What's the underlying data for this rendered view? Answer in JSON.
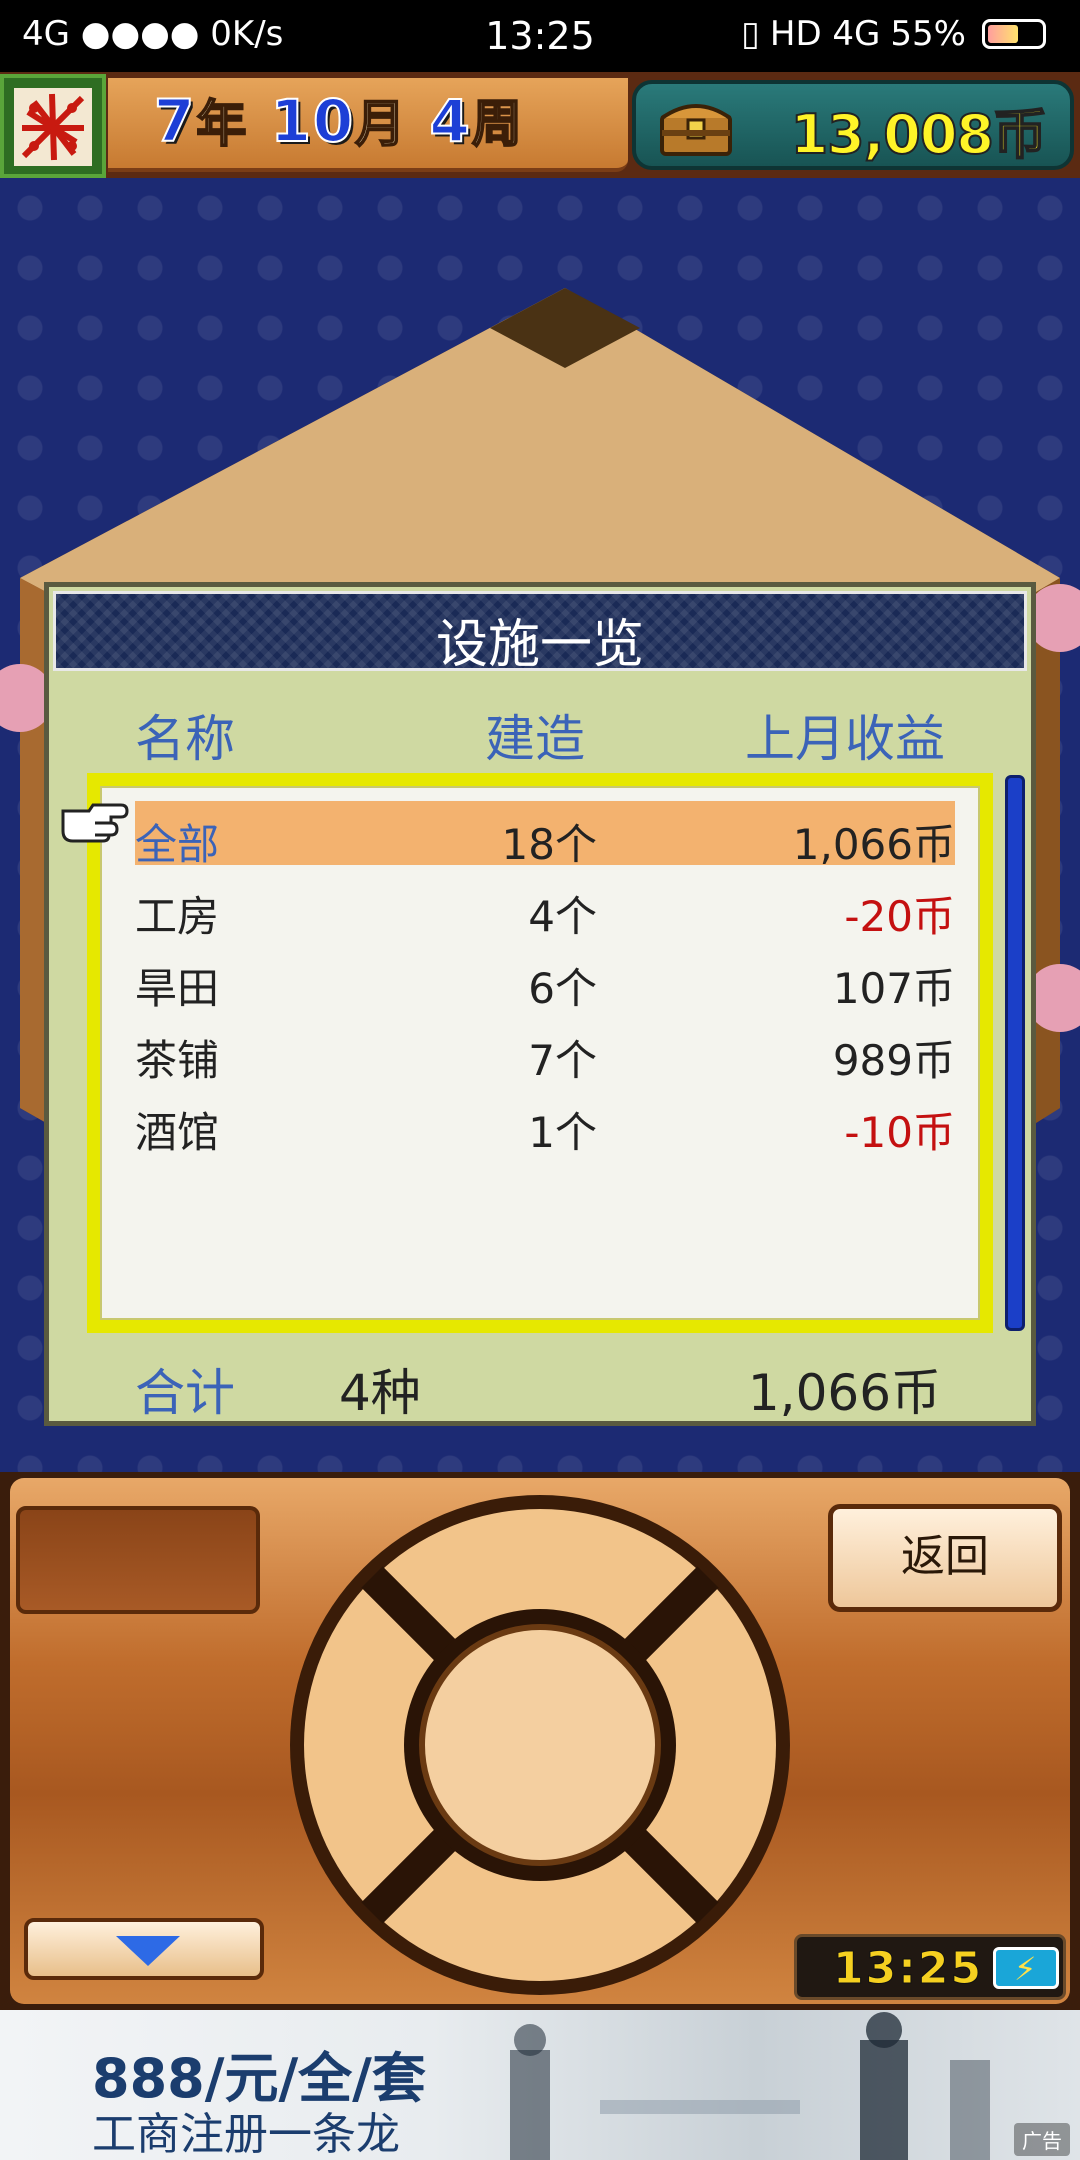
{
  "status_bar": {
    "network": "4G ●●●● 0K/s",
    "time": "13:25",
    "indicators": "HD 4G",
    "battery_percent": "55%",
    "battery_level": 0.55
  },
  "game_header": {
    "date": {
      "year": "7",
      "year_unit": "年",
      "month": "10",
      "month_unit": "月",
      "week": "4",
      "week_unit": "周"
    },
    "money": "13,008币"
  },
  "dialog": {
    "title": "设施一览",
    "columns": {
      "name": "名称",
      "built": "建造",
      "income": "上月收益"
    },
    "rows": [
      {
        "name": "全部",
        "count": "18个",
        "income": "1,066币",
        "negative": false,
        "selected": true
      },
      {
        "name": "工房",
        "count": "4个",
        "income": "-20币",
        "negative": true,
        "selected": false
      },
      {
        "name": "旱田",
        "count": "6个",
        "income": "107币",
        "negative": false,
        "selected": false
      },
      {
        "name": "茶铺",
        "count": "7个",
        "income": "989币",
        "negative": false,
        "selected": false
      },
      {
        "name": "酒馆",
        "count": "1个",
        "income": "-10币",
        "negative": true,
        "selected": false
      }
    ],
    "total": {
      "label": "合计",
      "kinds": "4种",
      "value": "1,066币"
    }
  },
  "controls": {
    "back_label": "返回",
    "clock": "13:25"
  },
  "ad": {
    "line1": "888/元/全/套",
    "line2": "工商注册一条龙",
    "tag": "广告"
  },
  "colors": {
    "accent_blue": "#3b63b8",
    "negative_red": "#c41010",
    "selected_row": "#f3b26f",
    "money_yellow": "#fff428",
    "game_bg": "#1c2a73"
  }
}
